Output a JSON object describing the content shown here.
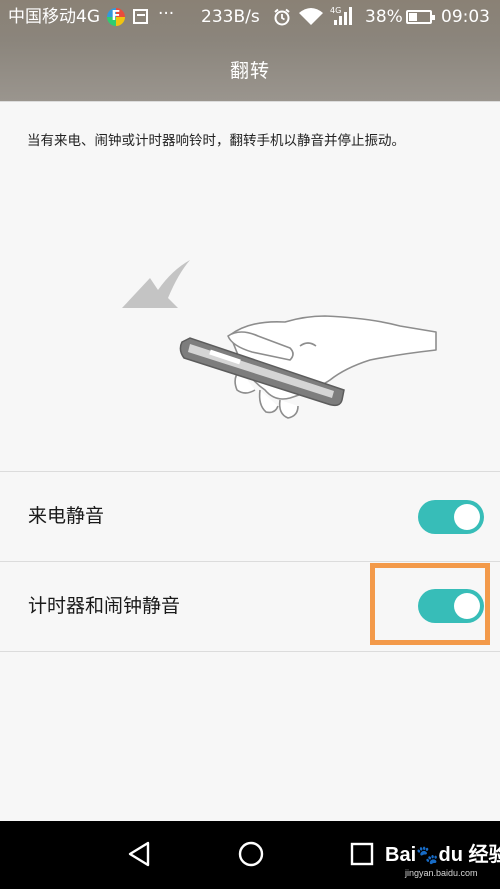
{
  "status_bar": {
    "carrier": "中国移动4G",
    "app_badge_letter": "F",
    "more": "···",
    "speed": "233B/s",
    "network_badge": "4G",
    "battery": "38%",
    "battery_level": 0.38,
    "time": "09:03"
  },
  "header": {
    "title": "翻转"
  },
  "description": "当有来电、闹钟或计时器响铃时，翻转手机以静音并停止振动。",
  "settings": [
    {
      "label": "来电静音",
      "enabled": true
    },
    {
      "label": "计时器和闹钟静音",
      "enabled": true
    }
  ],
  "colors": {
    "toggle_on": "#37bdb8",
    "highlight": "#f39a4a",
    "nav_bar": "#000000"
  },
  "nav_bar": {
    "icons": [
      "back-triangle-icon",
      "home-circle-icon",
      "recents-square-icon"
    ]
  },
  "watermark": {
    "brand": "Bai",
    "brand_end": "du",
    "cn": "经验",
    "url": "jingyan.baidu.com"
  }
}
